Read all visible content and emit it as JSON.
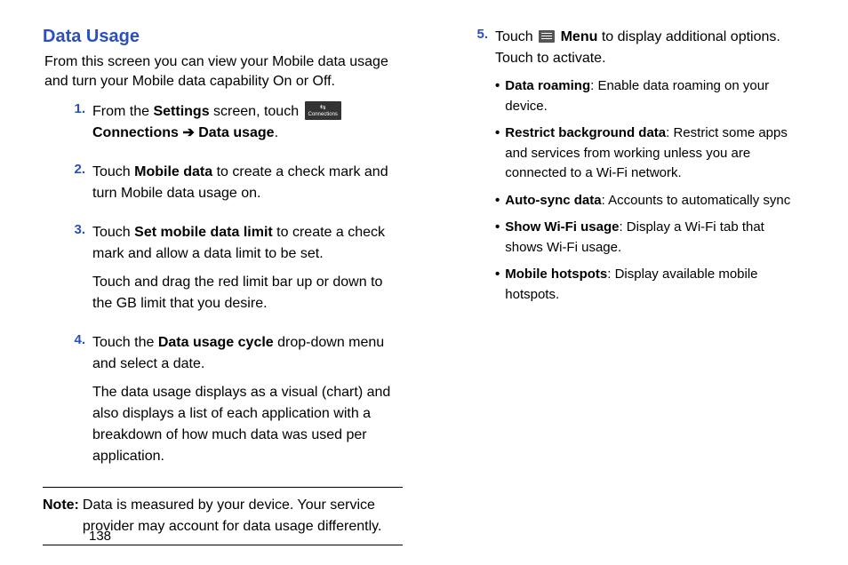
{
  "heading": "Data Usage",
  "intro": "From this screen you can view your Mobile data usage and turn your Mobile data capability On or Off.",
  "steps": {
    "s1": {
      "num": "1.",
      "pre": "From the ",
      "b1": "Settings",
      "mid1": " screen, touch ",
      "iconLabel": "Connections",
      "b2": "Connections",
      "arrow": " ➔ ",
      "b3": "Data usage",
      "end": "."
    },
    "s2": {
      "num": "2.",
      "pre": "Touch ",
      "b1": "Mobile data",
      "rest": " to create a check mark and turn Mobile data usage on."
    },
    "s3": {
      "num": "3.",
      "pre": "Touch ",
      "b1": "Set mobile data limit",
      "rest": " to create a check mark and allow a data limit to be set.",
      "p2": "Touch and drag the red limit bar up or down to the GB limit that you desire."
    },
    "s4": {
      "num": "4.",
      "pre": "Touch the ",
      "b1": "Data usage cycle",
      "rest": " drop-down menu and select a date.",
      "p2": "The data usage displays as a visual (chart) and also displays a list of each application with a breakdown of how much data was used per application."
    },
    "s5": {
      "num": "5.",
      "pre": "Touch ",
      "b1": "Menu",
      "rest": " to display additional options. Touch to activate."
    }
  },
  "note": {
    "label": "Note:",
    "text": "Data is measured by your device. Your service provider may account for data usage differently."
  },
  "bullets": {
    "b1": {
      "label": "Data roaming",
      "text": ": Enable data roaming on your device."
    },
    "b2": {
      "label": "Restrict background data",
      "text": ": Restrict some apps and services from working unless you are connected to a Wi-Fi network."
    },
    "b3": {
      "label": "Auto-sync data",
      "text": ": Accounts to automatically sync"
    },
    "b4": {
      "label": "Show Wi-Fi usage",
      "text": ": Display a Wi-Fi tab that shows Wi-Fi usage."
    },
    "b5": {
      "label": "Mobile hotspots",
      "text": ": Display available mobile hotspots."
    }
  },
  "pageNum": "138"
}
